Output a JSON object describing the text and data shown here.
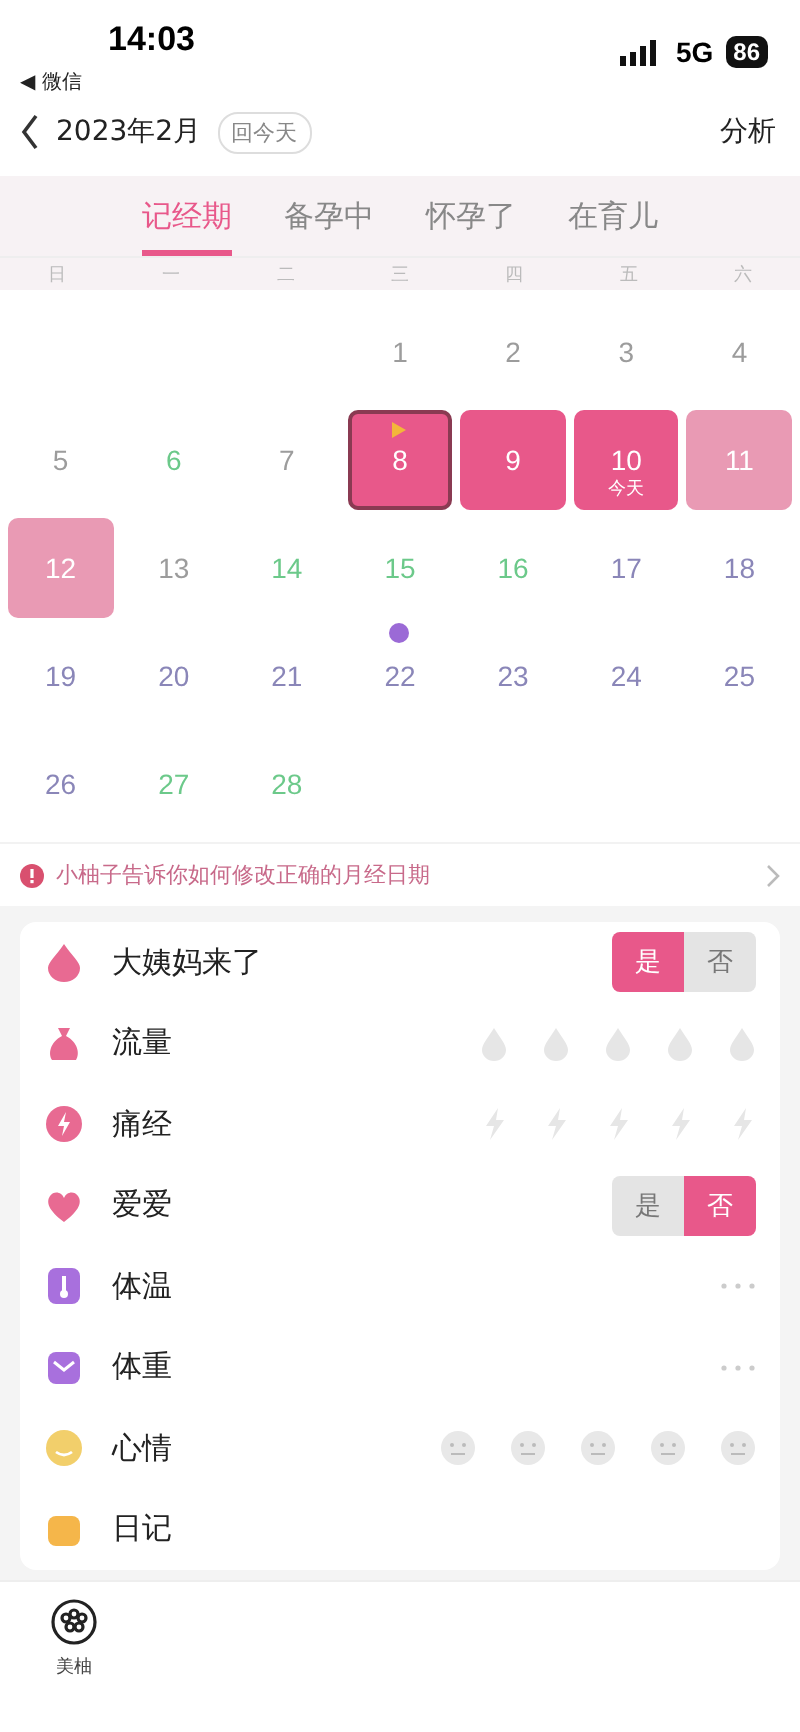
{
  "status_bar": {
    "time": "14:03",
    "back_app": "◀ 微信",
    "network": "5G",
    "battery": "86"
  },
  "header": {
    "title": "2023年2月",
    "today_button": "回今天",
    "action": "分析"
  },
  "tabs": [
    {
      "label": "记经期",
      "selected": true
    },
    {
      "label": "备孕中",
      "selected": false
    },
    {
      "label": "怀孕了",
      "selected": false
    },
    {
      "label": "在育儿",
      "selected": false
    }
  ],
  "weekdays": [
    "日",
    "一",
    "二",
    "三",
    "四",
    "五",
    "六"
  ],
  "days": [
    {
      "kind": "empty"
    },
    {
      "kind": "empty"
    },
    {
      "kind": "empty"
    },
    {
      "kind": "plain",
      "day": "1",
      "color": "#9c9c9c",
      "selected": false
    },
    {
      "kind": "plain",
      "day": "2",
      "color": "#9c9c9c",
      "selected": false
    },
    {
      "kind": "plain",
      "day": "3",
      "color": "#9c9c9c",
      "selected": false
    },
    {
      "kind": "plain",
      "day": "4",
      "color": "#9c9c9c",
      "selected": false
    },
    {
      "kind": "plain",
      "day": "5",
      "color": "#9c9c9c",
      "selected": false
    },
    {
      "kind": "plain",
      "day": "6",
      "color": "#6cc98a",
      "selected": false
    },
    {
      "kind": "plain",
      "day": "7",
      "color": "#9c9c9c",
      "selected": false
    },
    {
      "kind": "period",
      "day": "8",
      "selected": true,
      "period_start": true
    },
    {
      "kind": "period",
      "day": "9",
      "selected": false
    },
    {
      "kind": "period",
      "day": "10",
      "selected": false,
      "note": "今天"
    },
    {
      "kind": "predicted",
      "day": "11",
      "selected": false
    },
    {
      "kind": "predicted",
      "day": "12",
      "selected": false
    },
    {
      "kind": "plain",
      "day": "13",
      "color": "#9c9c9c",
      "selected": false
    },
    {
      "kind": "plain",
      "day": "14",
      "color": "#6cc98a",
      "selected": false
    },
    {
      "kind": "plain",
      "day": "15",
      "color": "#6cc98a",
      "selected": false
    },
    {
      "kind": "plain",
      "day": "16",
      "color": "#6cc98a",
      "selected": false
    },
    {
      "kind": "plain",
      "day": "17",
      "color": "#8a86b8",
      "selected": false
    },
    {
      "kind": "plain",
      "day": "18",
      "color": "#8a86b8",
      "selected": false
    },
    {
      "kind": "plain",
      "day": "19",
      "color": "#8a86b8",
      "selected": false
    },
    {
      "kind": "plain",
      "day": "20",
      "color": "#8a86b8",
      "selected": false
    },
    {
      "kind": "plain",
      "day": "21",
      "color": "#8a86b8",
      "selected": false
    },
    {
      "kind": "plain",
      "day": "22",
      "color": "#8a86b8",
      "selected": false,
      "ovulation": true
    },
    {
      "kind": "plain",
      "day": "23",
      "color": "#8a86b8",
      "selected": false
    },
    {
      "kind": "plain",
      "day": "24",
      "color": "#8a86b8",
      "selected": false
    },
    {
      "kind": "plain",
      "day": "25",
      "color": "#8a86b8",
      "selected": false
    },
    {
      "kind": "plain",
      "day": "26",
      "color": "#8a86b8",
      "selected": false
    },
    {
      "kind": "plain",
      "day": "27",
      "color": "#6cc98a",
      "selected": false
    },
    {
      "kind": "plain",
      "day": "28",
      "color": "#6cc98a",
      "selected": false
    }
  ],
  "tip": "小柚子告诉你如何修改正确的月经日期",
  "records": [
    {
      "kind": "yesno",
      "label": "大姨妈来了",
      "options": [
        {
          "label": "是",
          "selected": true
        },
        {
          "label": "否",
          "selected": false
        }
      ]
    },
    {
      "kind": "drops",
      "label": "流量",
      "stars": 0
    },
    {
      "kind": "bolts",
      "label": "痛经",
      "stars": 0
    },
    {
      "kind": "yesno",
      "label": "爱爱",
      "options": [
        {
          "label": "是",
          "selected": false
        },
        {
          "label": "否",
          "selected": true
        }
      ]
    },
    {
      "kind": "more",
      "label": "体温"
    },
    {
      "kind": "more",
      "label": "体重"
    },
    {
      "kind": "mood",
      "label": "心情"
    },
    {
      "kind": "plain",
      "label": "日记"
    }
  ],
  "bottom_nav": [
    {
      "label": "美柚"
    }
  ]
}
